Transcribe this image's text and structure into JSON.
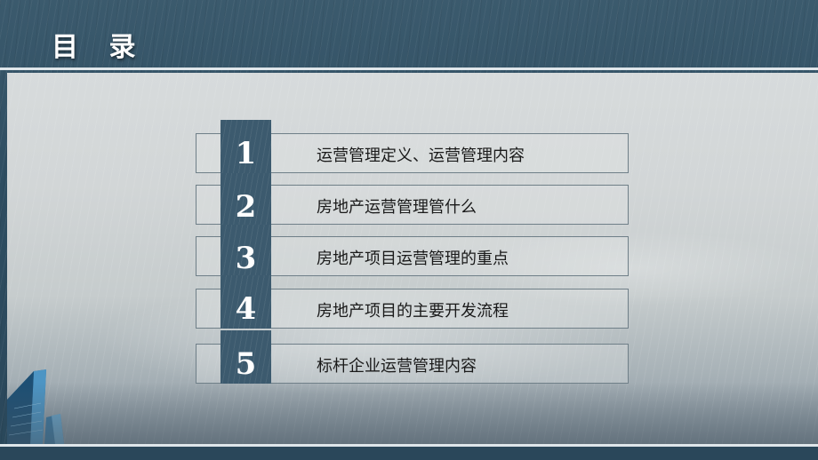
{
  "title": "目 录",
  "items": [
    {
      "number": "1",
      "label": "运营管理定义、运营管理内容"
    },
    {
      "number": "2",
      "label": "房地产运营管理管什么"
    },
    {
      "number": "3",
      "label": "房地产项目运营管理的重点"
    },
    {
      "number": "4",
      "label": "房地产项目的主要开发流程"
    },
    {
      "number": "5",
      "label": "标杆企业运营管理内容"
    }
  ],
  "colors": {
    "frame": "#2e4d61",
    "number_block": "#3c5a6e",
    "line": "#dfe6ea"
  }
}
